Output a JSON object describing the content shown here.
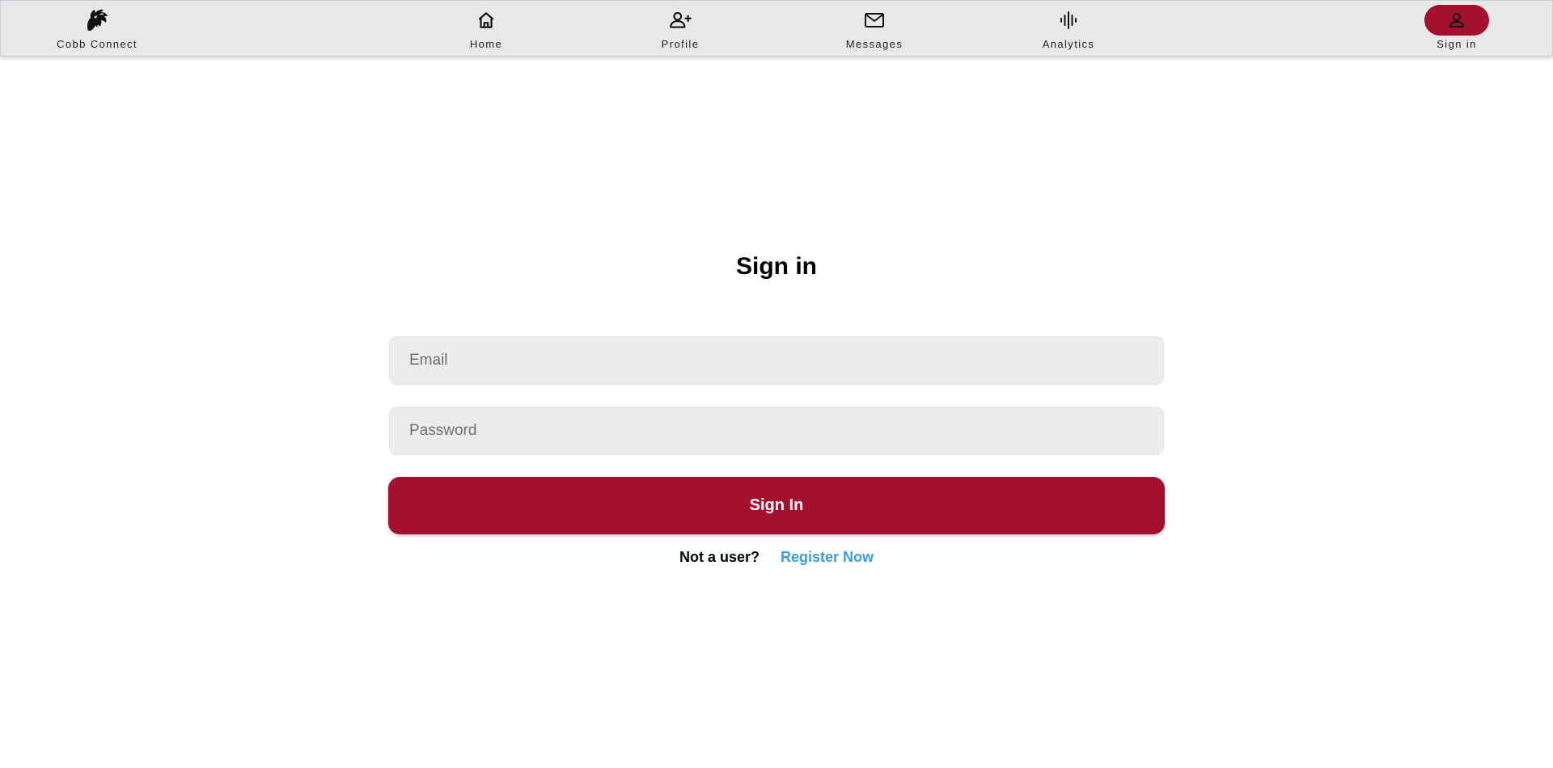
{
  "nav": {
    "brand_label": "Cobb Connect",
    "items": [
      {
        "label": "Home",
        "icon": "home-icon"
      },
      {
        "label": "Profile",
        "icon": "add-user-icon"
      },
      {
        "label": "Messages",
        "icon": "mail-icon"
      },
      {
        "label": "Analytics",
        "icon": "audio-waveform-icon"
      }
    ],
    "signin_label": "Sign in",
    "signin_icon": "user-icon"
  },
  "form": {
    "title": "Sign in",
    "email_placeholder": "Email",
    "password_placeholder": "Password",
    "submit_label": "Sign In",
    "not_user_text": "Not a user?",
    "register_label": "Register Now"
  },
  "colors": {
    "accent": "#a6102f",
    "link": "#3a9be0",
    "navbar_bg": "#e8e8e9",
    "input_bg": "#ececec"
  }
}
